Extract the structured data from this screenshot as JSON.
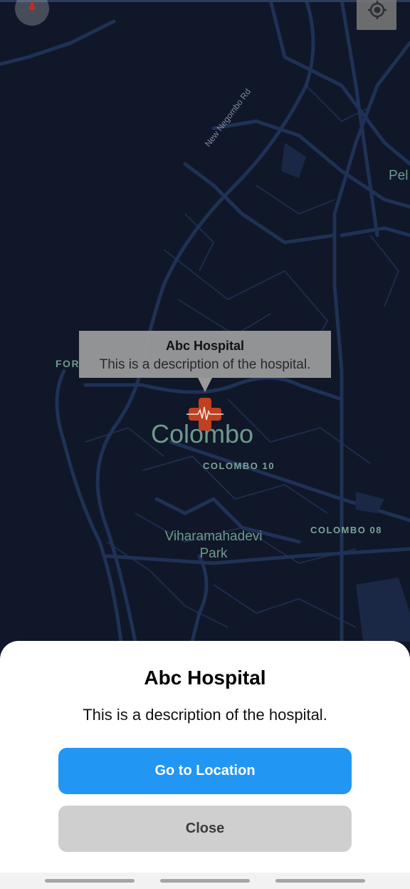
{
  "map": {
    "labels": {
      "city": "Colombo",
      "district_10": "COLOMBO 10",
      "district_08": "COLOMBO 08",
      "park": "Viharamahadevi Park",
      "road": "New Negombo Rd",
      "pel": "Pel",
      "fort": "FOR"
    },
    "compass_icon": "compass-icon",
    "locate_icon": "my-location-icon",
    "marker_icon": "hospital-cross-icon",
    "colors": {
      "background": "#0f1729",
      "roads": "#1f3154",
      "label": "#6f9a8c",
      "marker": "#c0401f"
    }
  },
  "info_window": {
    "title": "Abc Hospital",
    "description": "This is a description of the hospital."
  },
  "sheet": {
    "title": "Abc Hospital",
    "description": "This is a description of the hospital.",
    "primary_button": "Go to Location",
    "secondary_button": "Close",
    "colors": {
      "primary": "#2196f3",
      "secondary": "#cfcfcf"
    }
  }
}
